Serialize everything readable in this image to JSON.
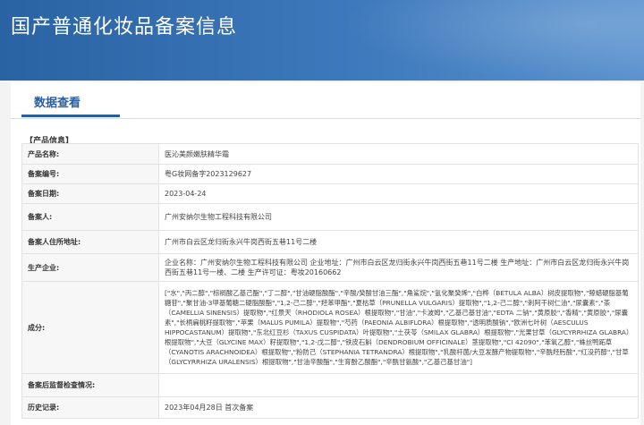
{
  "header": {
    "title": "国产普通化妆品备案信息"
  },
  "tabs": [
    {
      "label": "数据查看"
    }
  ],
  "section": {
    "title": "【产品信息】"
  },
  "rows": [
    {
      "label": "产品名称:",
      "value": "医沁美颜嫩肤精华霜"
    },
    {
      "label": "备案编号:",
      "value": "粤G妆网备字2023129627"
    },
    {
      "label": "备案日期:",
      "value": "2023-04-24"
    },
    {
      "label": "备案人:",
      "value": "广州安纳尔生物工程科技有限公司"
    },
    {
      "label": "备案人住所地址:",
      "value": "广州市白云区龙归街永兴牛岗西街五巷11号二楼"
    },
    {
      "label": "生产企业:",
      "value": "企业名称：广州安纳尔生物工程科技有限公司 企业地址：广州市白云区龙归街永兴牛岗西街五巷11号二楼 生产地址：广州市白云区龙归街永兴牛岗西街五巷11号一楼、二楼 生产许可证：粤妆20160662"
    },
    {
      "label": "成分:",
      "value": "[\"水\",\"丙二醇\",\"棕榈酸乙基己酯\",\"丁二醇\",\"甘油硬脂酸酯\",\"辛酸/癸酸甘油三酯\",\"角鲨烷\",\"氢化聚癸烯\",\"白桦（BETULA ALBA）树皮提取物\",\"鲸蜡硬脂基葡糖苷\",\"聚甘油-3甲基葡糖二硬脂酸酯\",\"1,2-己二醇\",\"羟苯甲酯\",\"夏枯草（PRUNELLA VULGARIS）提取物\",\"1,2-己二醇\",\"刺阿干树仁油\",\"尿囊素\",\"茶（CAMELLIA SINENSIS）提取物\",\"红景天（RHODIOLA ROSEA）根提取物\",\"甘油\",\"卡波姆\",\"乙基己基甘油\",\"EDTA 二钠\",\"黄原胶\",\"香精\",\"黄原胶\",\"尿囊素\",\"长柄扁桃籽提取物\",\"苹果（MALUS PUMILA）提取物\",\"芍药（PAEONIA ALBIFLORA）根提取物\",\"透明质酸钠\",\"欧洲七叶树（AESCULUS HIPPOCASTANUM）提取物\",\"东北红豆杉（TAXUS CUSPIDATA）叶提取物\",\"土茯苓（SMILAX GLABRA）根提取物\",\"光果甘草（GLYCYRRHIZA GLABRA）根提取物\",\"大豆（GLYCINE MAX）籽提取物\",\"1,2-戊二醇\",\"铁皮石斛（DENDROBIUM OFFICINALE）茎提取物\",\"CI 42090\",\"苯氧乙醇\",\"蛛丝鸭跖草（CYANOTIS ARACHNOIDEA）根提取物\",\"粉防己（STEPHANIA TETRANDRA）根提取物\",\"乳酸杆菌/大豆发酵产物提取物\",\"辛酰羟肟酸\",\"红没药醇\",\"甘草（GLYCYRRHIZA URALENSIS）根提取物\",\"甘油辛酸酯\",\"生育酚乙酸酯\",\"辛酰甘氨酸\",\"乙基己基甘油\"]"
    },
    {
      "label": "备案后监督检查情况:",
      "value": ""
    },
    {
      "label": "历史记录:",
      "value": "2023年04月28日 首次备案"
    }
  ],
  "colors": {
    "banner": "#2a63a3",
    "accent": "#2a5f9e",
    "label_bg": "#f7f7f7",
    "border": "#e3e3e3"
  }
}
